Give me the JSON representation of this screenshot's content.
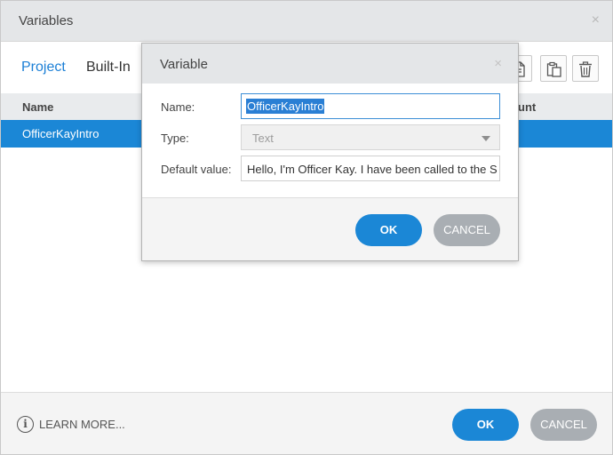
{
  "window": {
    "title": "Variables",
    "close_glyph": "×"
  },
  "tabs": [
    {
      "label": "Project",
      "active": true
    },
    {
      "label": "Built-In",
      "active": false
    }
  ],
  "toolbar": {
    "icons": [
      "new-document-icon",
      "paste-icon",
      "trash-icon"
    ]
  },
  "table": {
    "columns": {
      "name": "Name",
      "count_partial": "unt"
    },
    "rows": [
      {
        "name": "OfficerKayIntro",
        "selected": true
      }
    ]
  },
  "footer": {
    "learn_more": "LEARN MORE...",
    "info_glyph": "i",
    "ok": "OK",
    "cancel": "CANCEL"
  },
  "modal": {
    "title": "Variable",
    "close_glyph": "×",
    "name_label": "Name:",
    "name_value": "OfficerKayIntro",
    "type_label": "Type:",
    "type_value": "Text",
    "default_label": "Default value:",
    "default_value": "Hello, I'm Officer Kay. I have been called to the S",
    "ok": "OK",
    "cancel": "CANCEL"
  },
  "colors": {
    "accent": "#1b87d6",
    "cancel_gray": "#a9aeb3",
    "titlebar": "#e4e6e8"
  }
}
